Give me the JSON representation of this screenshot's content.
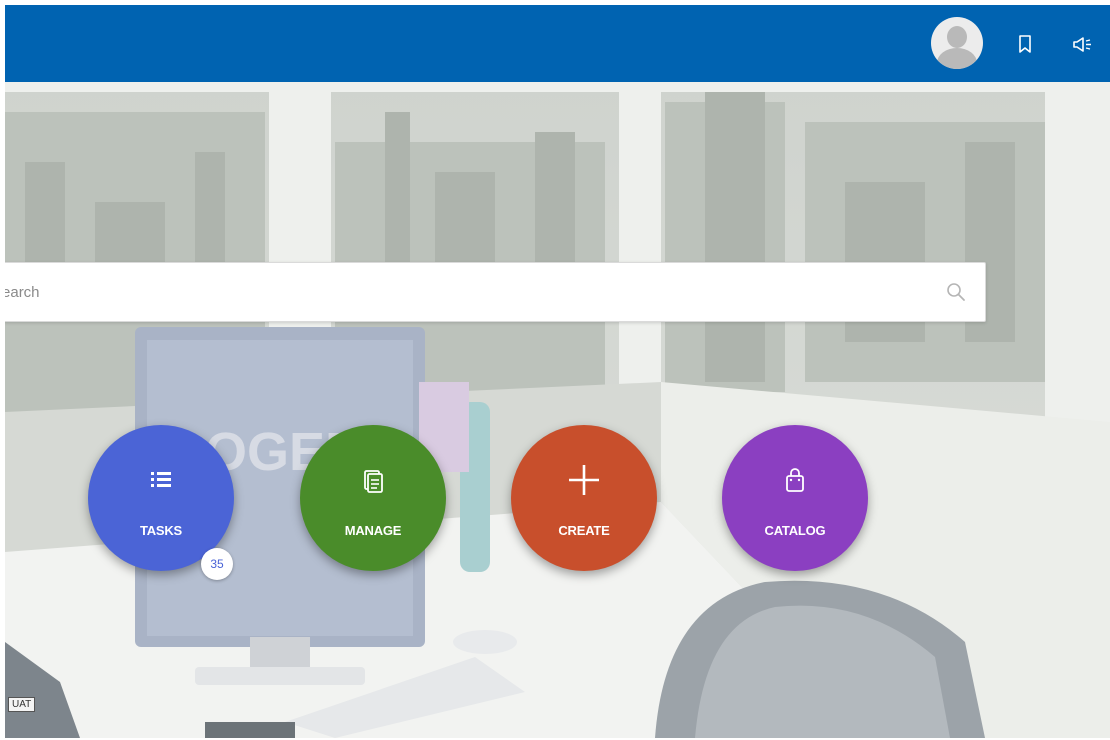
{
  "colors": {
    "topbar": "#0063b1",
    "tasks": "#4b64d6",
    "manage": "#4a8c2a",
    "create": "#c84f2c",
    "catalog": "#8b3fc1"
  },
  "header": {
    "avatar_icon": "user-avatar-icon",
    "bookmark_icon": "bookmark-icon",
    "announce_icon": "megaphone-icon"
  },
  "search": {
    "placeholder": "Search",
    "icon": "search-icon"
  },
  "actions": [
    {
      "label": "TASKS",
      "icon": "list-icon",
      "badge": "35"
    },
    {
      "label": "MANAGE",
      "icon": "documents-icon"
    },
    {
      "label": "CREATE",
      "icon": "plus-icon"
    },
    {
      "label": "CATALOG",
      "icon": "shopping-bag-icon"
    }
  ],
  "scene": {
    "monitor_brand": "OGER"
  },
  "environment_tag": "UAT"
}
